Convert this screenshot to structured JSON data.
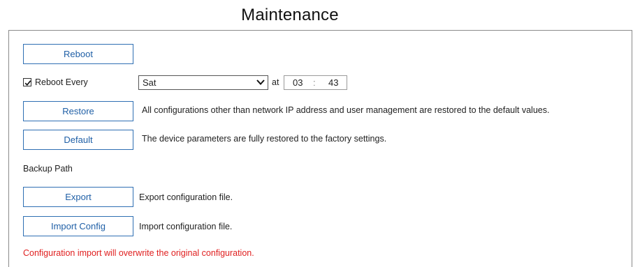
{
  "page": {
    "title": "Maintenance"
  },
  "reboot": {
    "button_label": "Reboot"
  },
  "reboot_every": {
    "label": "Reboot Every",
    "checked": true,
    "day_selected": "Sat",
    "at_label": "at",
    "hour": "03",
    "separator": ":",
    "minute": "43"
  },
  "restore": {
    "button_label": "Restore",
    "description": "All configurations other than network IP address and user management are restored to the default values."
  },
  "default": {
    "button_label": "Default",
    "description": "The device parameters are fully restored to the factory settings."
  },
  "backup": {
    "label": "Backup Path",
    "export_label": "Export",
    "export_description": "Export configuration file.",
    "import_label": "Import Config",
    "import_description": "Import configuration file.",
    "warning": "Configuration import will overwrite the original configuration."
  },
  "colors": {
    "button_border": "#2f6fb3",
    "button_text": "#1f5fa6",
    "warning_text": "#e02020"
  },
  "icons": {
    "checkbox": "checkmark-icon",
    "select": "chevron-down-icon"
  }
}
